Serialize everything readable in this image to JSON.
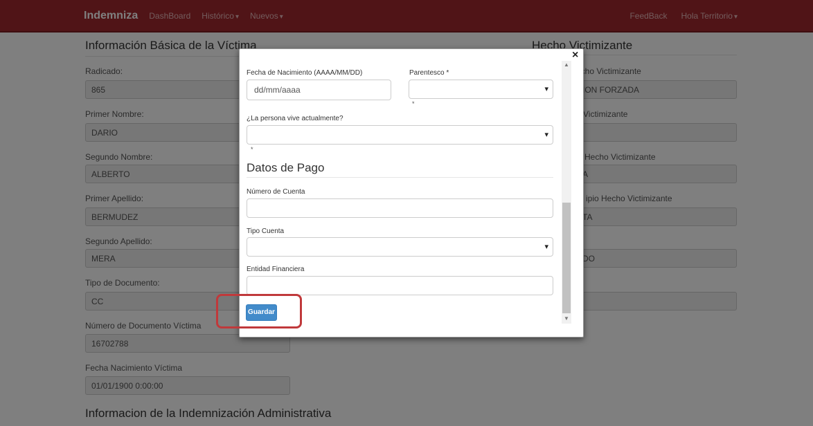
{
  "navbar": {
    "brand": "Indemniza",
    "links": [
      "DashBoard",
      "Histórico",
      "Nuevos"
    ],
    "right_links": [
      "FeedBack",
      "Hola Territorio"
    ]
  },
  "victim": {
    "title": "Información Básica de la Víctima",
    "fields": [
      {
        "label": "Radicado:",
        "value": "865"
      },
      {
        "label": "Primer Nombre:",
        "value": "DARIO"
      },
      {
        "label": "Segundo Nombre:",
        "value": "ALBERTO"
      },
      {
        "label": "Primer Apellido:",
        "value": "BERMUDEZ"
      },
      {
        "label": "Segundo Apellido:",
        "value": "MERA"
      },
      {
        "label": "Tipo de Documento:",
        "value": "CC"
      },
      {
        "label": "Número de Documento Víctima",
        "value": "16702788"
      },
      {
        "label": "Fecha Nacimiento Víctima",
        "value": "01/01/1900 0:00:00"
      }
    ]
  },
  "hecho": {
    "title": "Hecho Victimizante",
    "fields": [
      {
        "label": "echo Victimizante",
        "value": "ION FORZADA"
      },
      {
        "label": "Victimizante",
        "value": ""
      },
      {
        "label": "Hecho Victimizante",
        "value": "A"
      },
      {
        "label": "ipio Hecho Victimizante",
        "value": "TA"
      },
      {
        "label": "",
        "value": "DO"
      },
      {
        "label": "",
        "value": ""
      }
    ]
  },
  "indemnizacion": {
    "title": "Informacion de la Indemnización Administrativa"
  },
  "modal": {
    "close": "×",
    "fecha_label": "Fecha de Nacimiento (AAAA/MM/DD)",
    "fecha_placeholder": "dd/mm/aaaa",
    "parentesco_label": "Parentesco *",
    "parentesco_value": "",
    "vive_label": "¿La persona vive actualmente?",
    "vive_value": "",
    "required_mark": "*",
    "pago_heading": "Datos de Pago",
    "cuenta_label": "Número de Cuenta",
    "cuenta_value": "",
    "tipo_label": "Tipo Cuenta",
    "tipo_value": "",
    "entidad_label": "Entidad Financiera",
    "entidad_value": "",
    "save_label": "Guardar"
  },
  "colors": {
    "navbar": "#a0292e",
    "primary": "#428bca",
    "highlight": "#c0393b"
  }
}
